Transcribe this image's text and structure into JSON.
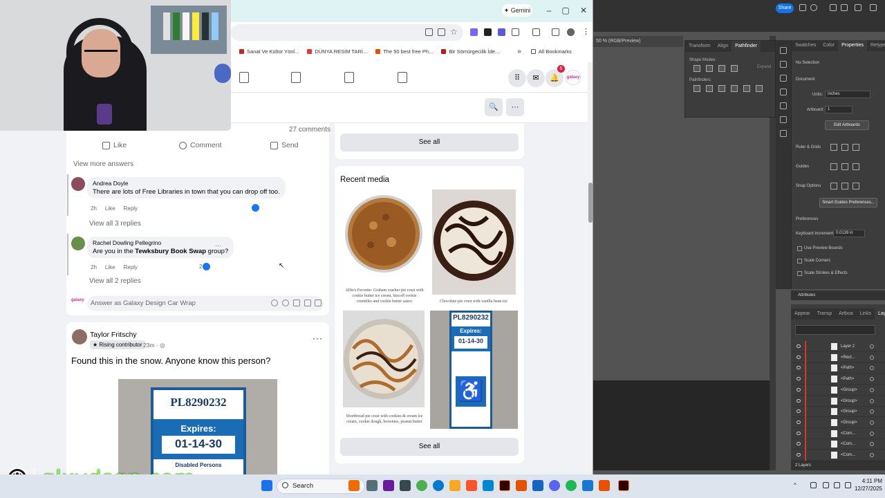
{
  "browser": {
    "gemini_label": "Gemini",
    "bookmarks": [
      {
        "label": "Sanat Ve Kültür Yönl...",
        "color": "#c62828"
      },
      {
        "label": "DÜNYA RESİM TARİ...",
        "color": "#e53935"
      },
      {
        "label": "The 50 best free Ph...",
        "color": "#e65100"
      },
      {
        "label": "Bir Sömürgecilik İde...",
        "color": "#b71c1c"
      }
    ],
    "all_bookmarks": "All Bookmarks",
    "overflow": "»"
  },
  "facebook": {
    "notifications_count": "6",
    "avatar_text": "galaxy",
    "post1": {
      "comments_count": "27 comments",
      "actions": [
        "Like",
        "Comment",
        "Send"
      ],
      "view_more_answers": "View more answers",
      "comments": [
        {
          "author": "Andrea Doyle",
          "text": "There are lots of Free Libraries in town that you can drop off too.",
          "time": "2h",
          "like": "Like",
          "reply": "Reply",
          "view_replies": "View all 3 replies"
        },
        {
          "author": "Rachel Dowling Pellegrino",
          "text_pre": "Are you in the ",
          "text_bold": "Tewksbury Book Swap",
          "text_post": " group?",
          "time": "2h",
          "like": "Like",
          "reply": "Reply",
          "reaction_count": "2",
          "view_replies": "View all 2 replies"
        }
      ],
      "answer_placeholder": "Answer as Galaxy Design Car Wrap",
      "answer_avatar_text": "galaxy"
    },
    "post2": {
      "author": "Taylor Fritschy",
      "badge": "Rising contributor",
      "time": "23m",
      "menu": "···",
      "text": "Found this in the snow. Anyone know this person?",
      "tag_number": "PL8290232",
      "tag_expires": "Expires:",
      "tag_date": "01-14-30",
      "tag_footer": "Disabled Persons"
    },
    "right_column": {
      "see_all_top": "See all",
      "recent_media_title": "Recent media",
      "see_all_bottom": "See all",
      "media_captions": [
        "Alfie's Favorite: Graham cracker pie crust with cookie butter ice cream, biscoff cookie crumbles and cookie butter sauce",
        "Chocolate pie crust with vanilla bean ice",
        "Shortbread pie crust with cookies & cream ice cream, cookie dough, brownies, peanut butter",
        ""
      ],
      "media_tag_number": "PL8290232",
      "media_tag_expires": "Expires:",
      "media_tag_date": "01-14-30"
    }
  },
  "illustrator": {
    "share_label": "Share",
    "doc_tab": "50 % (RGB/Preview)",
    "pathfinder_tabs": [
      "Transform",
      "Align",
      "Pathfinder"
    ],
    "shape_modes_label": "Shape Modes:",
    "expand_label": "Expand",
    "pathfinders_label": "Pathfinders:",
    "props_tabs": [
      "Swatches",
      "Color",
      "Properties",
      "Retype"
    ],
    "no_selection": "No Selection",
    "document_label": "Document",
    "units_label": "Units:",
    "units_value": "Inches",
    "artboard_label": "Artboard:",
    "artboard_value": "1",
    "edit_artboards": "Edit Artboards",
    "ruler_grids": "Ruler & Grids",
    "guides": "Guides",
    "snap_options": "Snap Options",
    "smart_guides_prefs": "Smart Guides Preferences...",
    "preferences": "Preferences",
    "keyboard_increment_label": "Keyboard Increment:",
    "keyboard_increment_value": "0.0139 in",
    "checkboxes": [
      "Use Preview Bounds",
      "Scale Corners",
      "Scale Strokes & Effects"
    ],
    "attributes_header": "Attributes",
    "layers_tabs": [
      "Appear",
      "Transp",
      "Artboa",
      "Links",
      "Layers"
    ],
    "layers": [
      "Layer 2",
      "<Rect...",
      "<Path>",
      "<Path>",
      "<Group>",
      "<Group>",
      "<Group>",
      "<Group>",
      "<Com...",
      "<Com...",
      "<Com..."
    ],
    "layers_count": "2 Layers"
  },
  "watermark": {
    "text": "glxydsgn.com"
  },
  "taskbar": {
    "search_label": "Search",
    "time": "4:11 PM",
    "date": "12/27/2025"
  }
}
